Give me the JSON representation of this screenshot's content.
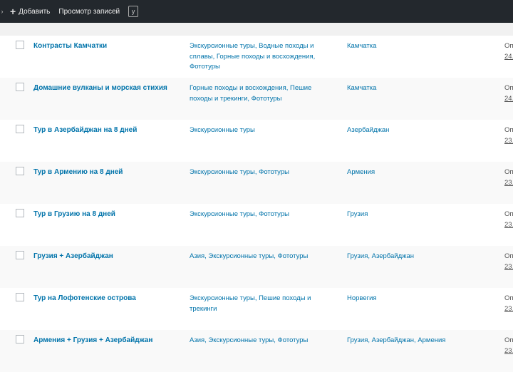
{
  "adminbar": {
    "add_label": "Добавить",
    "view_label": "Просмотр записей"
  },
  "posts": [
    {
      "title": "Контрасты Камчатки",
      "categories": "Экскурсионные туры, Водные походы и сплавы, Горные походы и восхождения, Фототуры",
      "region": "Камчатка",
      "status": "Оп",
      "date": "24."
    },
    {
      "title": "Домашние вулканы и морская стихия",
      "categories": "Горные походы и восхождения, Пешие походы и трекинги, Фототуры",
      "region": "Камчатка",
      "status": "Оп",
      "date": "24."
    },
    {
      "title": "Тур в Азербайджан на 8 дней",
      "categories": "Экскурсионные туры",
      "region": "Азербайджан",
      "status": "Оп",
      "date": "23."
    },
    {
      "title": "Тур в Армению на 8 дней",
      "categories": "Экскурсионные туры, Фототуры",
      "region": "Армения",
      "status": "Оп",
      "date": "23."
    },
    {
      "title": "Тур в Грузию на 8 дней",
      "categories": "Экскурсионные туры, Фототуры",
      "region": "Грузия",
      "status": "Оп",
      "date": "23."
    },
    {
      "title": "Грузия + Азербайджан",
      "categories": "Азия, Экскурсионные туры, Фототуры",
      "region": "Грузия, Азербайджан",
      "status": "Оп",
      "date": "23."
    },
    {
      "title": "Тур на Лофотенские острова",
      "categories": "Экскурсионные туры, Пешие походы и трекинги",
      "region": "Норвегия",
      "status": "Оп",
      "date": "23."
    },
    {
      "title": "Армения + Грузия + Азербайджан",
      "categories": "Азия, Экскурсионные туры, Фототуры",
      "region": "Грузия, Азербайджан, Армения",
      "status": "Оп",
      "date": "23."
    }
  ]
}
